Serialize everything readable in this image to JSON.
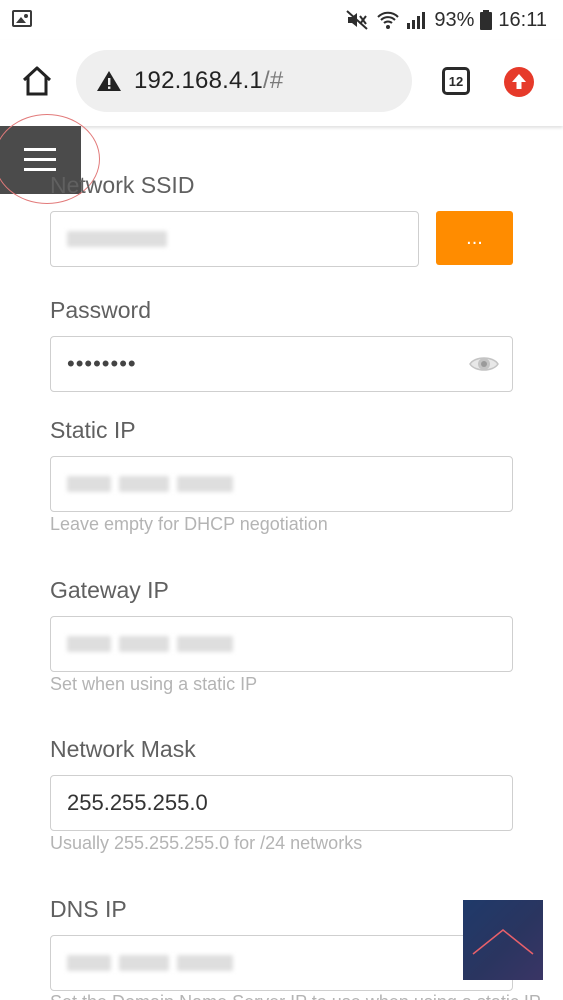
{
  "status_bar": {
    "battery_percent": "93%",
    "time": "16:11"
  },
  "browser": {
    "url_host": "192.168.4.1",
    "url_fragment": "/#",
    "tab_count": "12"
  },
  "form": {
    "ssid": {
      "label": "Network SSID",
      "scan_label": "..."
    },
    "password": {
      "label": "Password",
      "value": "••••••••"
    },
    "static_ip": {
      "label": "Static IP",
      "hint": "Leave empty for DHCP negotiation"
    },
    "gateway_ip": {
      "label": "Gateway IP",
      "hint": "Set when using a static IP"
    },
    "network_mask": {
      "label": "Network Mask",
      "value": "255.255.255.0",
      "hint": "Usually 255.255.255.0 for /24 networks"
    },
    "dns_ip": {
      "label": "DNS IP",
      "hint": "Set the Domain Name Server IP to use when using a static IP"
    }
  },
  "colors": {
    "scan_button": "#ff8c00",
    "menu_toggle": "#4b4b4b",
    "update_badge": "#e63a2a"
  }
}
